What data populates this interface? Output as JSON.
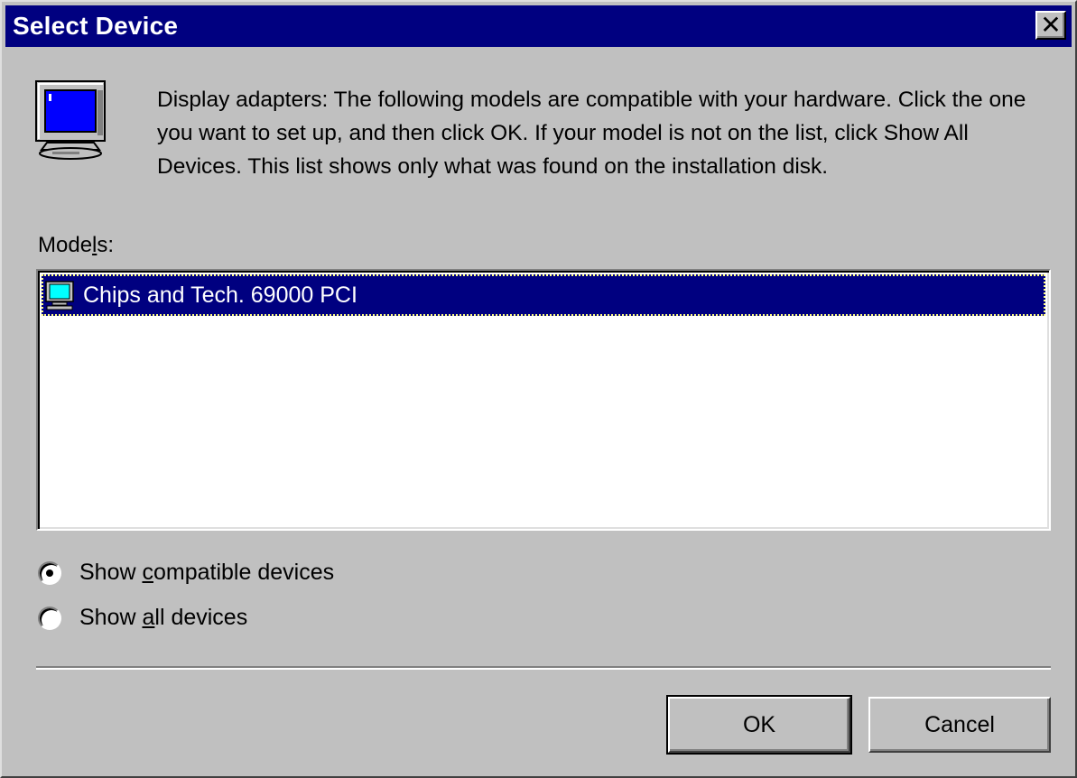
{
  "window": {
    "title": "Select Device",
    "close_glyph": "✕"
  },
  "icons": {
    "monitor": "monitor-icon",
    "list_item_icon": "display-adapter-icon",
    "close": "close-icon"
  },
  "description": "Display adapters: The following models are compatible with your hardware. Click the one you want to set up, and then click OK. If your model is not on the list, click Show All Devices. This list shows only what was found on the installation disk.",
  "models": {
    "label_prefix": "Mode",
    "label_accel": "l",
    "label_suffix": "s:",
    "items": [
      {
        "label": "Chips and Tech. 69000 PCI",
        "selected": true
      }
    ]
  },
  "options": {
    "compatible": {
      "prefix": "Show ",
      "accel": "c",
      "suffix": "ompatible devices",
      "checked": true
    },
    "all": {
      "prefix": "Show ",
      "accel": "a",
      "suffix": "ll devices",
      "checked": false
    }
  },
  "buttons": {
    "ok_label": "OK",
    "cancel_label": "Cancel"
  },
  "colors": {
    "titlebar": "#000080",
    "face": "#c0c0c0",
    "selection": "#000080"
  }
}
